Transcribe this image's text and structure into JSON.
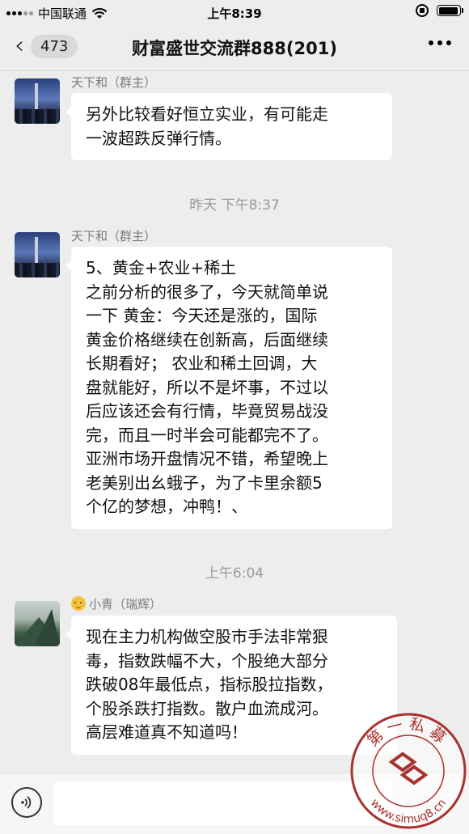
{
  "status_bar": {
    "carrier": "中国联通",
    "time": "上午8:39",
    "battery_level": 0.95
  },
  "nav": {
    "unread_count": "473",
    "title": "财富盛世交流群888(201)"
  },
  "messages": [
    {
      "sender": "天下和（群主）",
      "text": "另外比较看好恒立实业，有可能走\n一波超跌反弹行情。"
    },
    {
      "sender": "天下和（群主）",
      "text": "5、黄金+农业+稀土\n之前分析的很多了，今天就简单说\n一下 黄金：今天还是涨的，国际\n黄金价格继续在创新高，后面继续\n长期看好； 农业和稀土回调，大\n盘就能好，所以不是坏事，不过以\n后应该还会有行情，毕竟贸易战没\n完，而且一时半会可能都完不了。\n亚洲市场开盘情况不错，希望晚上\n老美别出幺蛾子，为了卡里余额5\n个亿的梦想，冲鸭！、"
    },
    {
      "sender": "小青（瑞辉）",
      "text": "现在主力机构做空股市手法非常狠\n毒，指数跌幅不大，个股绝大部分\n跌破08年最低点，指标股拉指数，\n个股杀跌打指数。散户血流成河。\n高层难道真不知道吗！"
    }
  ],
  "timestamps": [
    "昨天 下午8:37",
    "上午6:04"
  ],
  "input": {
    "placeholder": ""
  },
  "watermark": {
    "text_top": "第一私募",
    "text_bottom": "www.simuq8.cn"
  },
  "colors": {
    "background": "#ededed",
    "bubble": "#ffffff",
    "accent_watermark": "#a8322d"
  }
}
